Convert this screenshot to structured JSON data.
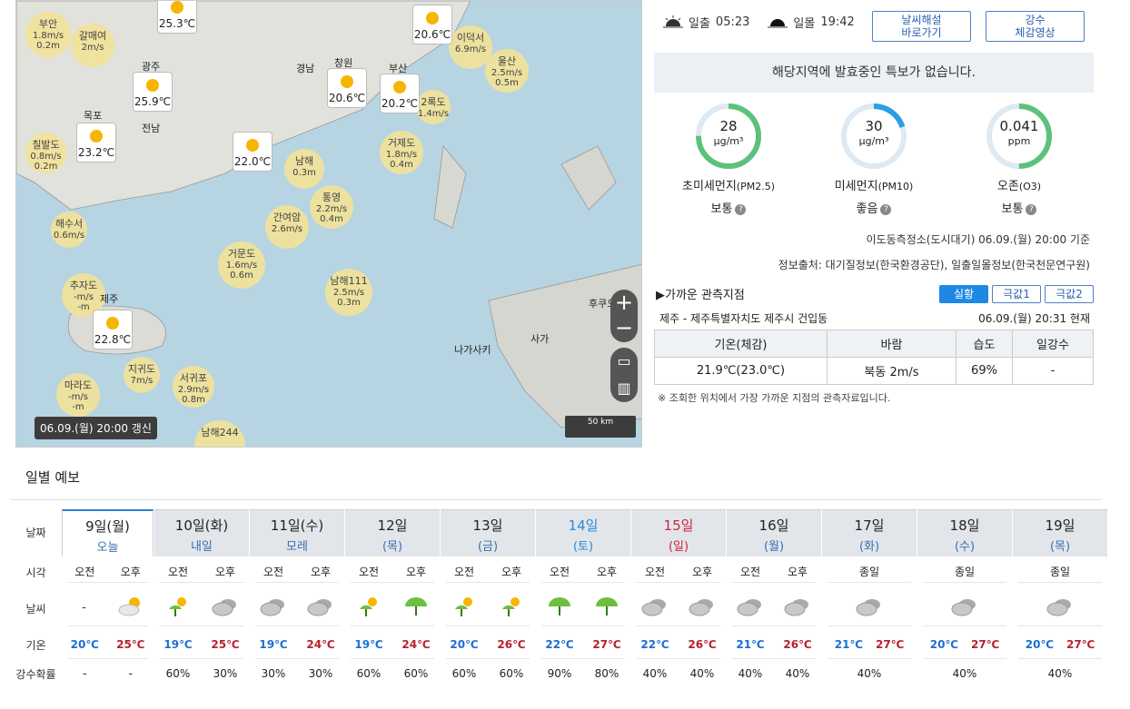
{
  "map": {
    "updated": "06.09.(월) 20:00 갱신",
    "scale": "50 km",
    "zoom_in": "+",
    "zoom_out": "−",
    "stations": [
      {
        "name": "부안",
        "v1": "1.8m/s",
        "v2": "0.2m"
      },
      {
        "name": "갈매여",
        "v1": "2m/s",
        "v2": ""
      },
      {
        "name": "칠발도",
        "v1": "0.8m/s",
        "v2": "0.2m"
      },
      {
        "name": "해수서",
        "v1": "0.6m/s",
        "v2": ""
      },
      {
        "name": "추자도",
        "v1": "-m/s",
        "v2": "-m"
      },
      {
        "name": "마라도",
        "v1": "-m/s",
        "v2": "-m"
      },
      {
        "name": "지귀도",
        "v1": "7m/s",
        "v2": ""
      },
      {
        "name": "서귀포",
        "v1": "2.9m/s",
        "v2": "0.8m"
      },
      {
        "name": "남해",
        "v1": "0.3m",
        "v2": ""
      },
      {
        "name": "통영",
        "v1": "2.2m/s",
        "v2": "0.4m"
      },
      {
        "name": "간여암",
        "v1": "2.6m/s",
        "v2": ""
      },
      {
        "name": "거문도",
        "v1": "1.6m/s",
        "v2": "0.6m"
      },
      {
        "name": "남해111",
        "v1": "2.5m/s",
        "v2": "0.3m"
      },
      {
        "name": "거제도",
        "v1": "1.8m/s",
        "v2": "0.4m"
      },
      {
        "name": "2록도",
        "v1": "1.4m/s",
        "v2": ""
      },
      {
        "name": "이덕서",
        "v1": "6.9m/s",
        "v2": ""
      },
      {
        "name": "울산",
        "v1": "2.5m/s",
        "v2": "0.5m"
      },
      {
        "name": "남해244",
        "v1": "",
        "v2": ""
      }
    ],
    "weather": [
      {
        "temp": "25.3℃"
      },
      {
        "temp": "25.9℃"
      },
      {
        "temp": "23.2℃"
      },
      {
        "temp": "22.0℃"
      },
      {
        "temp": "20.6℃"
      },
      {
        "temp": "20.2℃"
      },
      {
        "temp": "20.6℃"
      },
      {
        "temp": "22.8℃"
      }
    ],
    "cities": [
      "광주",
      "경남",
      "창원",
      "부산",
      "전남",
      "목포",
      "제주",
      "나가사키",
      "사가",
      "후쿠오"
    ]
  },
  "sun": {
    "rise_label": "일출",
    "rise": "05:23",
    "set_label": "일몰",
    "set": "19:42"
  },
  "buttons": {
    "b1a": "날씨해설",
    "b1b": "바로가기",
    "b2a": "강수",
    "b2b": "체감영상"
  },
  "alert": "해당지역에 발효중인 특보가 없습니다.",
  "air": [
    {
      "value": "28",
      "unit": "μg/m³",
      "label": "초미세먼지",
      "sub": "(PM2.5)",
      "status": "보통",
      "color": "#5cc27a",
      "fill": 0.75
    },
    {
      "value": "30",
      "unit": "μg/m³",
      "label": "미세먼지",
      "sub": "(PM10)",
      "status": "좋음",
      "color": "#2d9de6",
      "fill": 0.2
    },
    {
      "value": "0.041",
      "unit": "ppm",
      "label": "오존",
      "sub": "(O3)",
      "status": "보통",
      "color": "#5cc27a",
      "fill": 0.5
    }
  ],
  "air_station": "이도동측정소(도시대기) 06.09.(월) 20:00 기준",
  "source": "정보출처: 대기질정보(한국환경공단), 일출일몰정보(한국천문연구원)",
  "obs": {
    "title": "▶가까운 관측지점",
    "tabs": [
      "실황",
      "극값1",
      "극값2"
    ],
    "location": "제주 - 제주특별자치도 제주시 건입동",
    "time": "06.09.(월) 20:31 현재",
    "headers": [
      "기온(체감)",
      "바람",
      "습도",
      "일강수"
    ],
    "values": [
      "21.9℃(23.0℃)",
      "북동 2m/s",
      "69%",
      "-"
    ],
    "note": "※ 조회한 위치에서 가장 가까운 지점의 관측자료입니다."
  },
  "forecast": {
    "title": "일별 예보",
    "row_labels": [
      "날짜",
      "시각",
      "날씨",
      "기온",
      "강수확률"
    ],
    "days": [
      {
        "d": "9일(월)",
        "s": "오늘",
        "kind": "today",
        "slots": [
          "오전",
          "오후"
        ],
        "wx": [
          "none",
          "partly"
        ],
        "temps": [
          "20℃",
          "25℃"
        ],
        "pop": [
          "-",
          "-"
        ]
      },
      {
        "d": "10일(화)",
        "s": "내일",
        "kind": "",
        "slots": [
          "오전",
          "오후"
        ],
        "wx": [
          "shower",
          "cloud"
        ],
        "temps": [
          "19℃",
          "25℃"
        ],
        "pop": [
          "60%",
          "30%"
        ]
      },
      {
        "d": "11일(수)",
        "s": "모레",
        "kind": "",
        "slots": [
          "오전",
          "오후"
        ],
        "wx": [
          "cloud",
          "cloud"
        ],
        "temps": [
          "19℃",
          "24℃"
        ],
        "pop": [
          "30%",
          "30%"
        ]
      },
      {
        "d": "12일",
        "s": "(목)",
        "kind": "",
        "slots": [
          "오전",
          "오후"
        ],
        "wx": [
          "shower",
          "umbrella"
        ],
        "temps": [
          "19℃",
          "24℃"
        ],
        "pop": [
          "60%",
          "60%"
        ]
      },
      {
        "d": "13일",
        "s": "(금)",
        "kind": "",
        "slots": [
          "오전",
          "오후"
        ],
        "wx": [
          "shower",
          "shower"
        ],
        "temps": [
          "20℃",
          "26℃"
        ],
        "pop": [
          "60%",
          "60%"
        ]
      },
      {
        "d": "14일",
        "s": "(토)",
        "kind": "sat",
        "slots": [
          "오전",
          "오후"
        ],
        "wx": [
          "umbrella",
          "umbrella"
        ],
        "temps": [
          "22℃",
          "27℃"
        ],
        "pop": [
          "90%",
          "80%"
        ]
      },
      {
        "d": "15일",
        "s": "(일)",
        "kind": "sun",
        "slots": [
          "오전",
          "오후"
        ],
        "wx": [
          "cloud",
          "cloud"
        ],
        "temps": [
          "22℃",
          "26℃"
        ],
        "pop": [
          "40%",
          "40%"
        ]
      },
      {
        "d": "16일",
        "s": "(월)",
        "kind": "",
        "slots": [
          "오전",
          "오후"
        ],
        "wx": [
          "cloud",
          "cloud"
        ],
        "temps": [
          "21℃",
          "26℃"
        ],
        "pop": [
          "40%",
          "40%"
        ]
      },
      {
        "d": "17일",
        "s": "(화)",
        "kind": "",
        "slots": [
          "종일"
        ],
        "wx": [
          "cloud"
        ],
        "temps": [
          "21℃",
          "27℃"
        ],
        "pop": [
          "40%"
        ]
      },
      {
        "d": "18일",
        "s": "(수)",
        "kind": "",
        "slots": [
          "종일"
        ],
        "wx": [
          "cloud"
        ],
        "temps": [
          "20℃",
          "27℃"
        ],
        "pop": [
          "40%"
        ]
      },
      {
        "d": "19일",
        "s": "(목)",
        "kind": "",
        "slots": [
          "종일"
        ],
        "wx": [
          "cloud"
        ],
        "temps": [
          "20℃",
          "27℃"
        ],
        "pop": [
          "40%"
        ]
      }
    ]
  }
}
